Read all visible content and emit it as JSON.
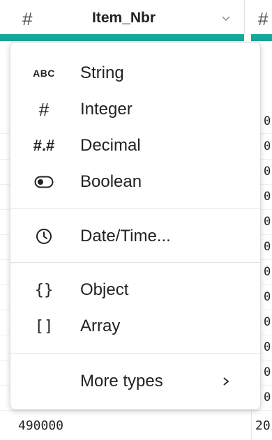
{
  "column": {
    "name": "Item_Nbr",
    "type_icon": "hash-icon",
    "accent_color": "#15a89a"
  },
  "menu": {
    "items": [
      {
        "icon": "abc-icon",
        "icon_text": "ABC",
        "label": "String"
      },
      {
        "icon": "hash-icon",
        "icon_text": "#",
        "label": "Integer"
      },
      {
        "icon": "decimal-icon",
        "icon_text": "#.#",
        "label": "Decimal"
      },
      {
        "icon": "toggle-icon",
        "label": "Boolean"
      },
      {
        "icon": "clock-icon",
        "label": "Date/Time..."
      },
      {
        "icon": "braces-icon",
        "icon_text": "{}",
        "label": "Object"
      },
      {
        "icon": "brackets-icon",
        "icon_text": "[]",
        "label": "Array"
      },
      {
        "icon": "chevron-right-icon",
        "label": "More types"
      }
    ]
  },
  "grid": {
    "right_cell_fragments": [
      "0",
      "0",
      "0",
      "0",
      "0",
      "0",
      "0",
      "0",
      "0",
      "0",
      "0",
      "0"
    ],
    "bottom_left_value": "490000",
    "bottom_right_value": "20"
  }
}
